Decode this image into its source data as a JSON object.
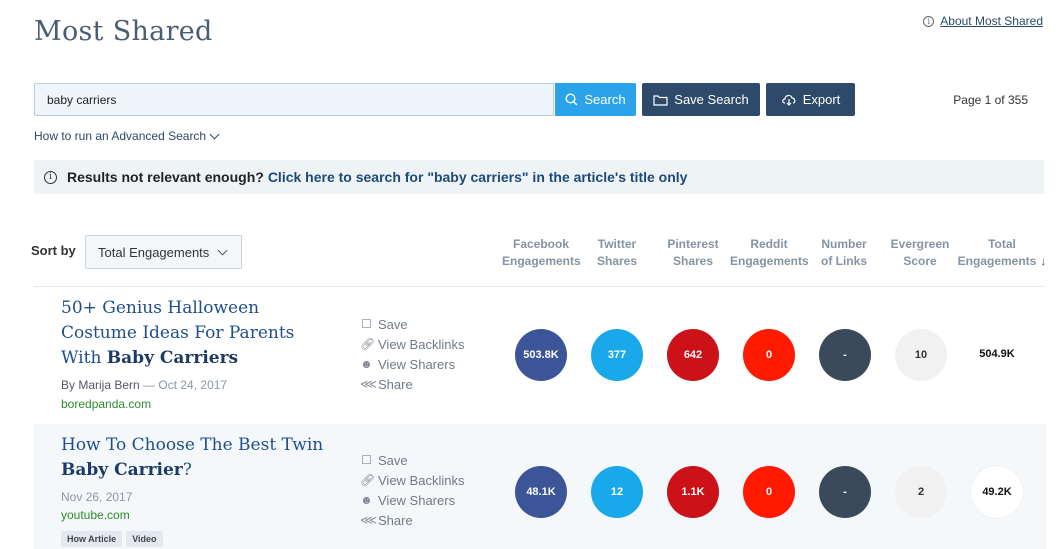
{
  "header": {
    "title": "Most Shared",
    "about_link": "About Most Shared"
  },
  "search": {
    "value": "baby carriers",
    "search_label": "Search",
    "save_label": "Save Search",
    "export_label": "Export",
    "page_info": "Page 1 of 355",
    "advanced_label": "How to run an Advanced Search"
  },
  "notice": {
    "question": "Results not relevant enough?",
    "link": "Click here to search for \"baby carriers\" in the article's title only"
  },
  "sort": {
    "label": "Sort by",
    "selected": "Total Engagements"
  },
  "columns": [
    {
      "line1": "Facebook",
      "line2": "Engagements"
    },
    {
      "line1": "Twitter",
      "line2": "Shares"
    },
    {
      "line1": "Pinterest",
      "line2": "Shares"
    },
    {
      "line1": "Reddit",
      "line2": "Engagements"
    },
    {
      "line1": "Number",
      "line2": "of Links"
    },
    {
      "line1": "Evergreen",
      "line2": "Score"
    },
    {
      "line1": "Total",
      "line2": "Engagements"
    }
  ],
  "actions": {
    "save": "Save",
    "backlinks": "View Backlinks",
    "sharers": "View Sharers",
    "share": "Share"
  },
  "results": [
    {
      "title_line1": "50+ Genius Halloween",
      "title_line2": "Costume Ideas For Parents",
      "title_line3_plain": "With ",
      "title_line3_bold": "Baby Carriers",
      "author": "By Marija Bern",
      "date": " — Oct 24, 2017",
      "domain": "boredpanda.com",
      "facebook": "503.8K",
      "twitter": "377",
      "pinterest": "642",
      "reddit": "0",
      "links": "-",
      "evergreen": "10",
      "total": "504.9K"
    },
    {
      "title_line1": "How To Choose The Best Twin",
      "title_line2_bold": "Baby Carrier",
      "title_line2_plain": "?",
      "date": "Nov 26, 2017",
      "domain": "youtube.com",
      "tags": [
        "How Article",
        "Video"
      ],
      "facebook": "48.1K",
      "twitter": "12",
      "pinterest": "1.1K",
      "reddit": "0",
      "links": "-",
      "evergreen": "2",
      "total": "49.2K"
    }
  ]
}
